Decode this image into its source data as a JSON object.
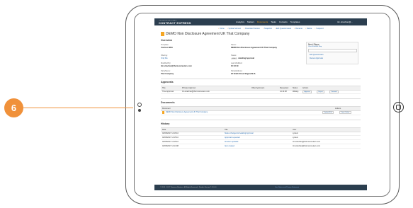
{
  "callout": {
    "number": "6"
  },
  "app": {
    "brand_top": "THOMSON REUTERS",
    "brand": "CONTRACT EXPRESS",
    "nav": [
      "Analytics",
      "Matters",
      "Documents",
      "Tasks",
      "Contacts",
      "Templates"
    ],
    "nav_active": "Documents",
    "user": "tim.strachan@..."
  },
  "actions": [
    "Clone",
    "Upload Version",
    "Download Version",
    "Snapshot",
    "Edit Questionnaire",
    "Rename",
    "Delete",
    "Suspend"
  ],
  "document": {
    "title": "DEMO Non Disclosure Agreement UK That Company"
  },
  "overview": {
    "heading": "Overview",
    "template_label": "Template:",
    "template_value": "Contoso NDA",
    "name_label": "Name:",
    "name_value": "DEMO Non Disclosure Agreement UK That Company",
    "sharing_label": "Sharing:",
    "sharing_value": "Only Me",
    "status_label": "Status:",
    "status_badge": "DRAFT",
    "status_value": "Awaiting Approval",
    "modified_by_label": "Modified By:",
    "modified_by_value": "tim.strachan@thomsonreuters.com",
    "last_modified_label": "Last Modified:",
    "last_modified_value": "10:13:19",
    "party_name_label": "PartyName:",
    "party_name_value": "That Company",
    "party_address_label": "PartyAddress:",
    "party_address_value": "23 Smith Street Edgerville IL"
  },
  "next_steps": {
    "title": "Next Steps",
    "subtitle": "View Workflow Map",
    "items": [
      "Edit Questionnaire",
      "Review Approvals"
    ]
  },
  "approvals": {
    "heading": "Approvals",
    "columns": [
      "Title",
      "Primary Approver",
      "Other Approvers",
      "Requested",
      "Status",
      "Actions"
    ],
    "rows": [
      {
        "title": "Time Approval",
        "primary": "tim.strachan@thomsonreuters.com",
        "other": "",
        "requested": "14:14:08",
        "status": "Waiting",
        "buttons": [
          "Approve",
          "Reject",
          "Forward"
        ]
      }
    ]
  },
  "documents": {
    "heading": "Documents",
    "columns": [
      "Document",
      "Actions"
    ],
    "rows": [
      {
        "name": "DEMO Non Disclosure Agreement UK That Company",
        "buttons": [
          "Upload File",
          "View Online"
        ]
      }
    ]
  },
  "history": {
    "heading": "History",
    "columns": [
      "Date",
      "Title",
      "User"
    ],
    "rows": [
      {
        "date": "02/08/2017 14:16:10",
        "title": "Status changed to Awaiting Approval",
        "user": "system"
      },
      {
        "date": "02/08/2017 14:15:10",
        "title": "Approval requested",
        "user": "system"
      },
      {
        "date": "02/08/2017 14:15:10",
        "title": "Answers updated",
        "user": "tim.strachan@thomsonreuters.com"
      },
      {
        "date": "02/08/2017 14:14:08",
        "title": "Item created",
        "user": "tim.strachan@thomsonreuters.com"
      }
    ]
  },
  "footer": {
    "copyright": "© 2015 - 2017 Thomson Reuters - All Rights Reserved - Product Version 7.2.0.0.0",
    "link": "User Notice and Privacy Statement"
  }
}
